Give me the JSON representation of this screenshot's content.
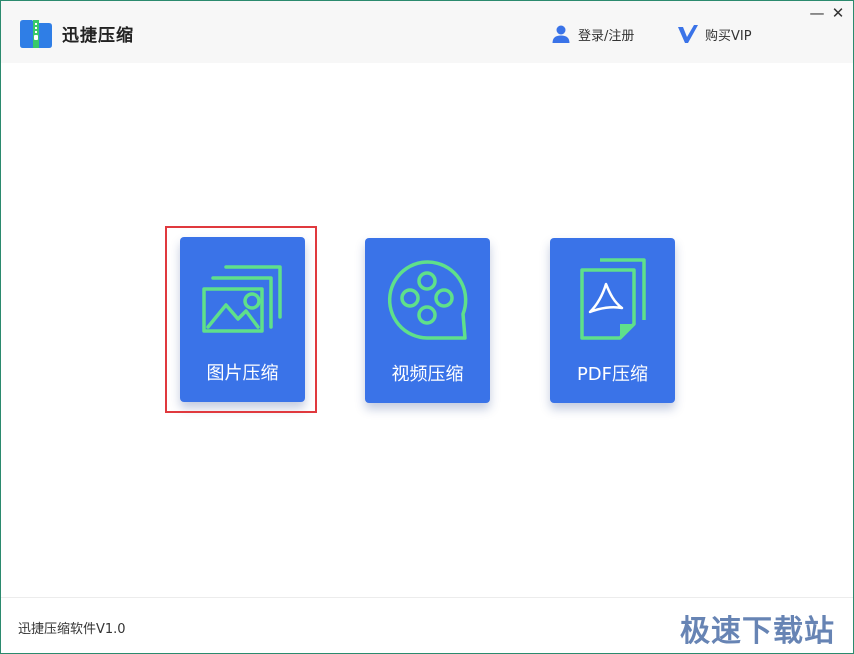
{
  "header": {
    "app_title": "迅捷压缩",
    "login_label": "登录/注册",
    "vip_label": "购买VIP",
    "minimize_symbol": "—",
    "close_symbol": "✕"
  },
  "cards": [
    {
      "label": "图片压缩",
      "icon": "image-icon"
    },
    {
      "label": "视频压缩",
      "icon": "film-reel-icon"
    },
    {
      "label": "PDF压缩",
      "icon": "pdf-document-icon"
    }
  ],
  "footer": {
    "version": "迅捷压缩软件V1.0",
    "watermark": "极速下载站"
  },
  "colors": {
    "card_bg": "#3a73e8",
    "icon_line": "#5fe08a",
    "selection": "#e0393e",
    "border": "#2b8a6e"
  }
}
